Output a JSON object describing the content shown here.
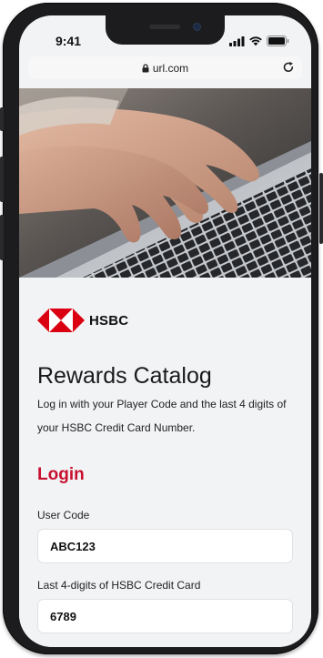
{
  "status_bar": {
    "time": "9:41"
  },
  "browser": {
    "url": "url.com"
  },
  "brand": {
    "name": "HSBC",
    "red": "#db0011",
    "login_red": "#c8102e"
  },
  "page": {
    "title": "Rewards Catalog",
    "subtitle": "Log in with your Player Code and the last 4 digits of your HSBC Credit Card Number."
  },
  "login": {
    "heading": "Login",
    "user_code_label": "User Code",
    "user_code_value": "ABC123",
    "card_label": "Last 4-digits of HSBC Credit Card",
    "card_value": "6789"
  },
  "icons": {
    "signal": "signal-icon",
    "wifi": "wifi-icon",
    "battery": "battery-icon",
    "lock": "lock-icon",
    "reload": "reload-icon"
  }
}
